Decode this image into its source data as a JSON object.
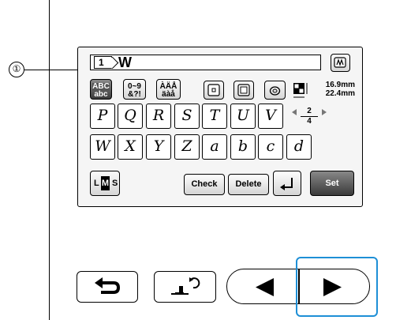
{
  "callout": {
    "number": "①"
  },
  "screen": {
    "text_display": {
      "line_number": "1",
      "typed_text": "W"
    },
    "char_type_buttons": [
      {
        "line1": "ABC",
        "line2": "abc"
      },
      {
        "line1": "0~9",
        "line2": "&?!"
      },
      {
        "line1": "ÀÄÅ",
        "line2": "äàå"
      }
    ],
    "size_display": {
      "width": "16.9mm",
      "height": "22.4mm"
    },
    "keys_row1": [
      "P",
      "Q",
      "R",
      "S",
      "T",
      "U",
      "V"
    ],
    "keys_row2": [
      "W",
      "X",
      "Y",
      "Z",
      "a",
      "b",
      "c",
      "d"
    ],
    "page": {
      "current": "2",
      "total": "4"
    },
    "size_selector": {
      "small_l": "L",
      "selected_m": "M",
      "small_s": "S"
    },
    "buttons": {
      "check": "Check",
      "delete": "Delete",
      "set": "Set"
    }
  },
  "colors": {
    "highlight": "#1e8fd6",
    "selected_button": "#3a3a3a"
  },
  "icons": [
    "bobbin-wind-icon",
    "frame-large-icon",
    "frame-small-icon",
    "hoop-icon",
    "density-icon",
    "return-icon",
    "presser-foot-rotate-icon",
    "left-arrow-icon",
    "right-arrow-icon",
    "enter-icon"
  ]
}
